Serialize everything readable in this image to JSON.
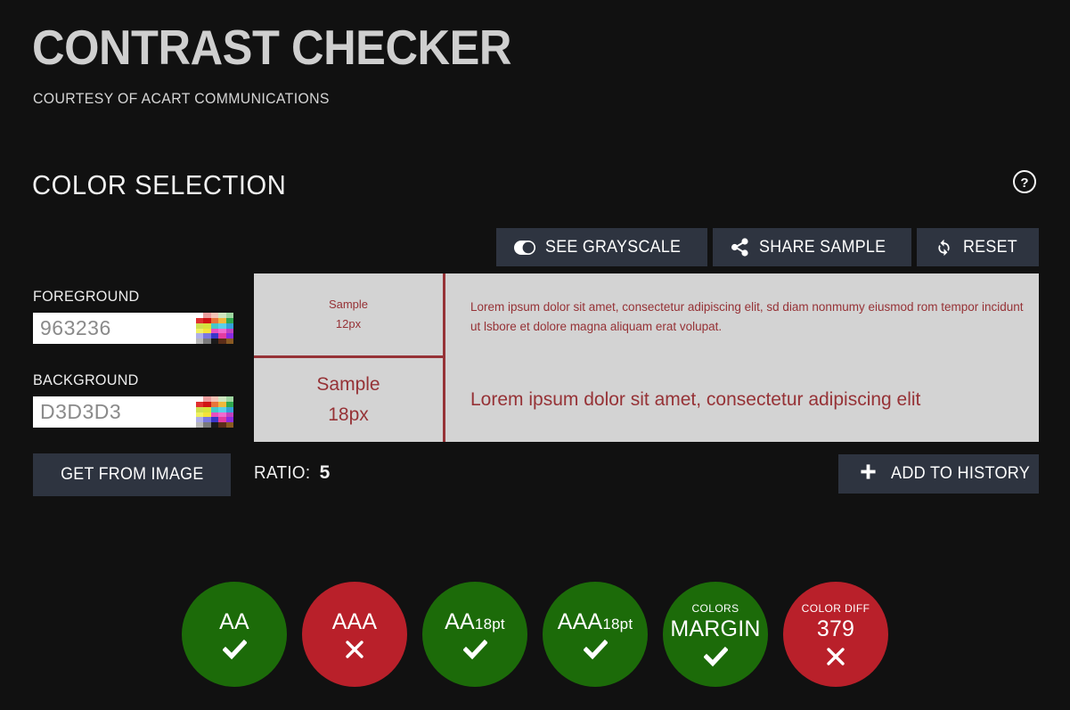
{
  "header": {
    "title": "CONTRAST CHECKER",
    "subtitle": "COURTESY OF ACART COMMUNICATIONS"
  },
  "section": {
    "title": "COLOR SELECTION",
    "help_icon": "question-circle-icon"
  },
  "toolbar": {
    "grayscale_label": "SEE GRAYSCALE",
    "grayscale_icon": "toggle-switch-icon",
    "share_label": "SHARE SAMPLE",
    "share_icon": "share-nodes-icon",
    "reset_label": "RESET",
    "reset_icon": "refresh-icon"
  },
  "controls": {
    "foreground_label": "FOREGROUND",
    "foreground_value": "963236",
    "foreground_placeholder": "963236",
    "background_label": "BACKGROUND",
    "background_value": "D3D3D3",
    "background_placeholder": "D3D3D3",
    "swatch_icon": "color-palette-icon",
    "get_from_image_label": "GET FROM IMAGE"
  },
  "sample": {
    "foreground_color": "#963236",
    "background_color": "#D3D3D3",
    "rows": [
      {
        "label": "Sample",
        "size": "12px",
        "text": "Lorem ipsum dolor sit amet, consectetur adipiscing elit, sd diam nonmumy eiusmod rom tempor incidunt ut lsbore et dolore magna aliquam erat volupat."
      },
      {
        "label": "Sample",
        "size": "18px",
        "text": "Lorem ipsum dolor sit amet, consectetur adipiscing elit"
      }
    ]
  },
  "results": {
    "ratio_label": "RATIO:",
    "ratio_value": "5",
    "add_history_label": "ADD TO HISTORY",
    "add_history_icon": "plus-icon"
  },
  "badges": [
    {
      "caption": "",
      "main": "AA",
      "sub": "",
      "state": "pass",
      "mark": "check-icon"
    },
    {
      "caption": "",
      "main": "AAA",
      "sub": "",
      "state": "fail",
      "mark": "cross-icon"
    },
    {
      "caption": "",
      "main": "AA",
      "sub": "18pt",
      "state": "pass",
      "mark": "check-icon"
    },
    {
      "caption": "",
      "main": "AAA",
      "sub": "18pt",
      "state": "pass",
      "mark": "check-icon"
    },
    {
      "caption": "COLORS",
      "main": "MARGIN",
      "sub": "",
      "state": "pass",
      "mark": "check-icon"
    },
    {
      "caption": "COLOR DIFF",
      "main": "379",
      "sub": "",
      "state": "fail",
      "mark": "cross-icon"
    }
  ],
  "palette": {
    "swatch_colors": [
      "#ffffff",
      "#eb9e9e",
      "#f5c3b5",
      "#cfe6c0",
      "#9ed6a0",
      "#e03030",
      "#d01414",
      "#e8743a",
      "#f0b83c",
      "#2fa84f",
      "#cfe050",
      "#d8e23c",
      "#46c8c8",
      "#5bd0e8",
      "#33a0d8",
      "#f0f060",
      "#f4e23a",
      "#e84fc0",
      "#f06ad0",
      "#c040c0",
      "#b0b0e8",
      "#7a78e0",
      "#3a36c8",
      "#e43ca0",
      "#8a2be2",
      "#b8b8b8",
      "#7a7a7a",
      "#1a1a1a",
      "#5a2d18",
      "#8a5a22"
    ]
  },
  "colors": {
    "pass": "#1c6b09",
    "fail": "#b9202a",
    "button": "#2e3440",
    "page_background": "#111111"
  }
}
